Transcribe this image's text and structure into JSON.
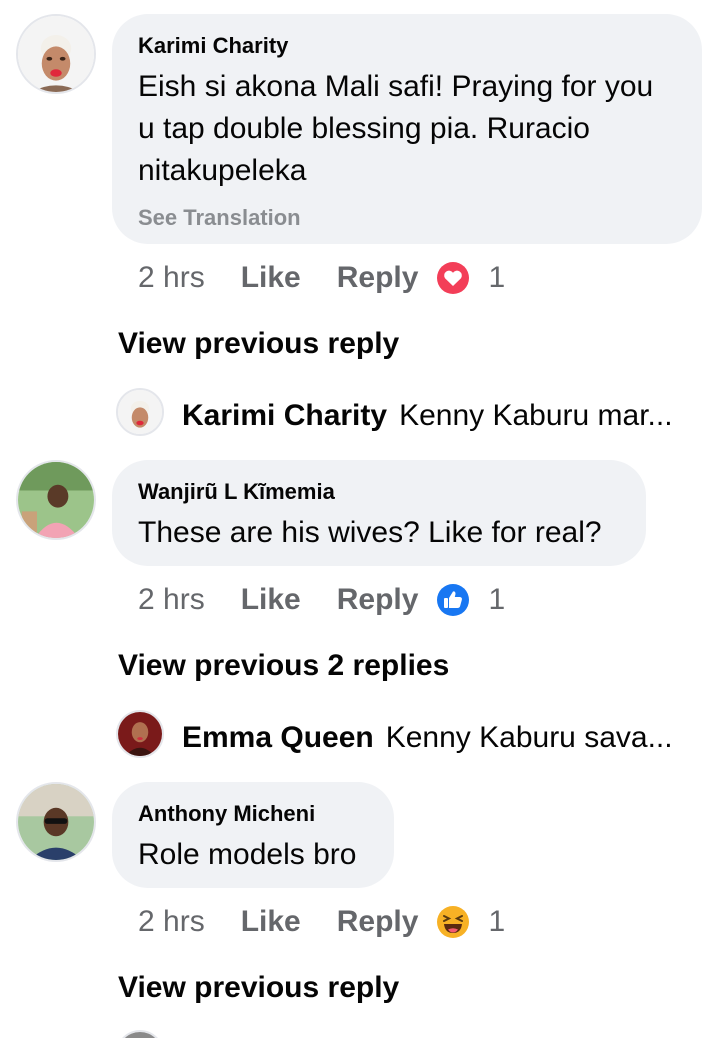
{
  "comments": [
    {
      "author": "Karimi Charity",
      "text": "Eish si akona Mali safi! Praying for you u tap double blessing pia. Ruracio nitakupeleka",
      "translate_label": "See Translation",
      "time": "2 hrs",
      "like_label": "Like",
      "reply_label": "Reply",
      "reaction": "love-reaction-icon",
      "reaction_count": "1",
      "view_previous": "View previous reply",
      "reply_preview": {
        "author": "Karimi Charity",
        "text": "Kenny Kaburu mar..."
      }
    },
    {
      "author": "Wanjirũ L Kĩmemia",
      "text": "These are his wives? Like for real?",
      "time": "2 hrs",
      "like_label": "Like",
      "reply_label": "Reply",
      "reaction": "like-reaction-icon",
      "reaction_count": "1",
      "view_previous": "View previous 2 replies",
      "reply_preview": {
        "author": "Emma Queen",
        "text": "Kenny Kaburu sava..."
      }
    },
    {
      "author": "Anthony Micheni",
      "text": "Role models bro",
      "time": "2 hrs",
      "like_label": "Like",
      "reply_label": "Reply",
      "reaction": "haha-reaction-icon",
      "reaction_count": "1",
      "view_previous": "View previous reply"
    }
  ],
  "colors": {
    "bubble_bg": "#f0f2f5",
    "meta_text": "#65676b",
    "translate_text": "#8a8d91",
    "love_red": "#f33e58",
    "like_blue": "#1877f2",
    "haha_yellow": "#f7b125"
  }
}
